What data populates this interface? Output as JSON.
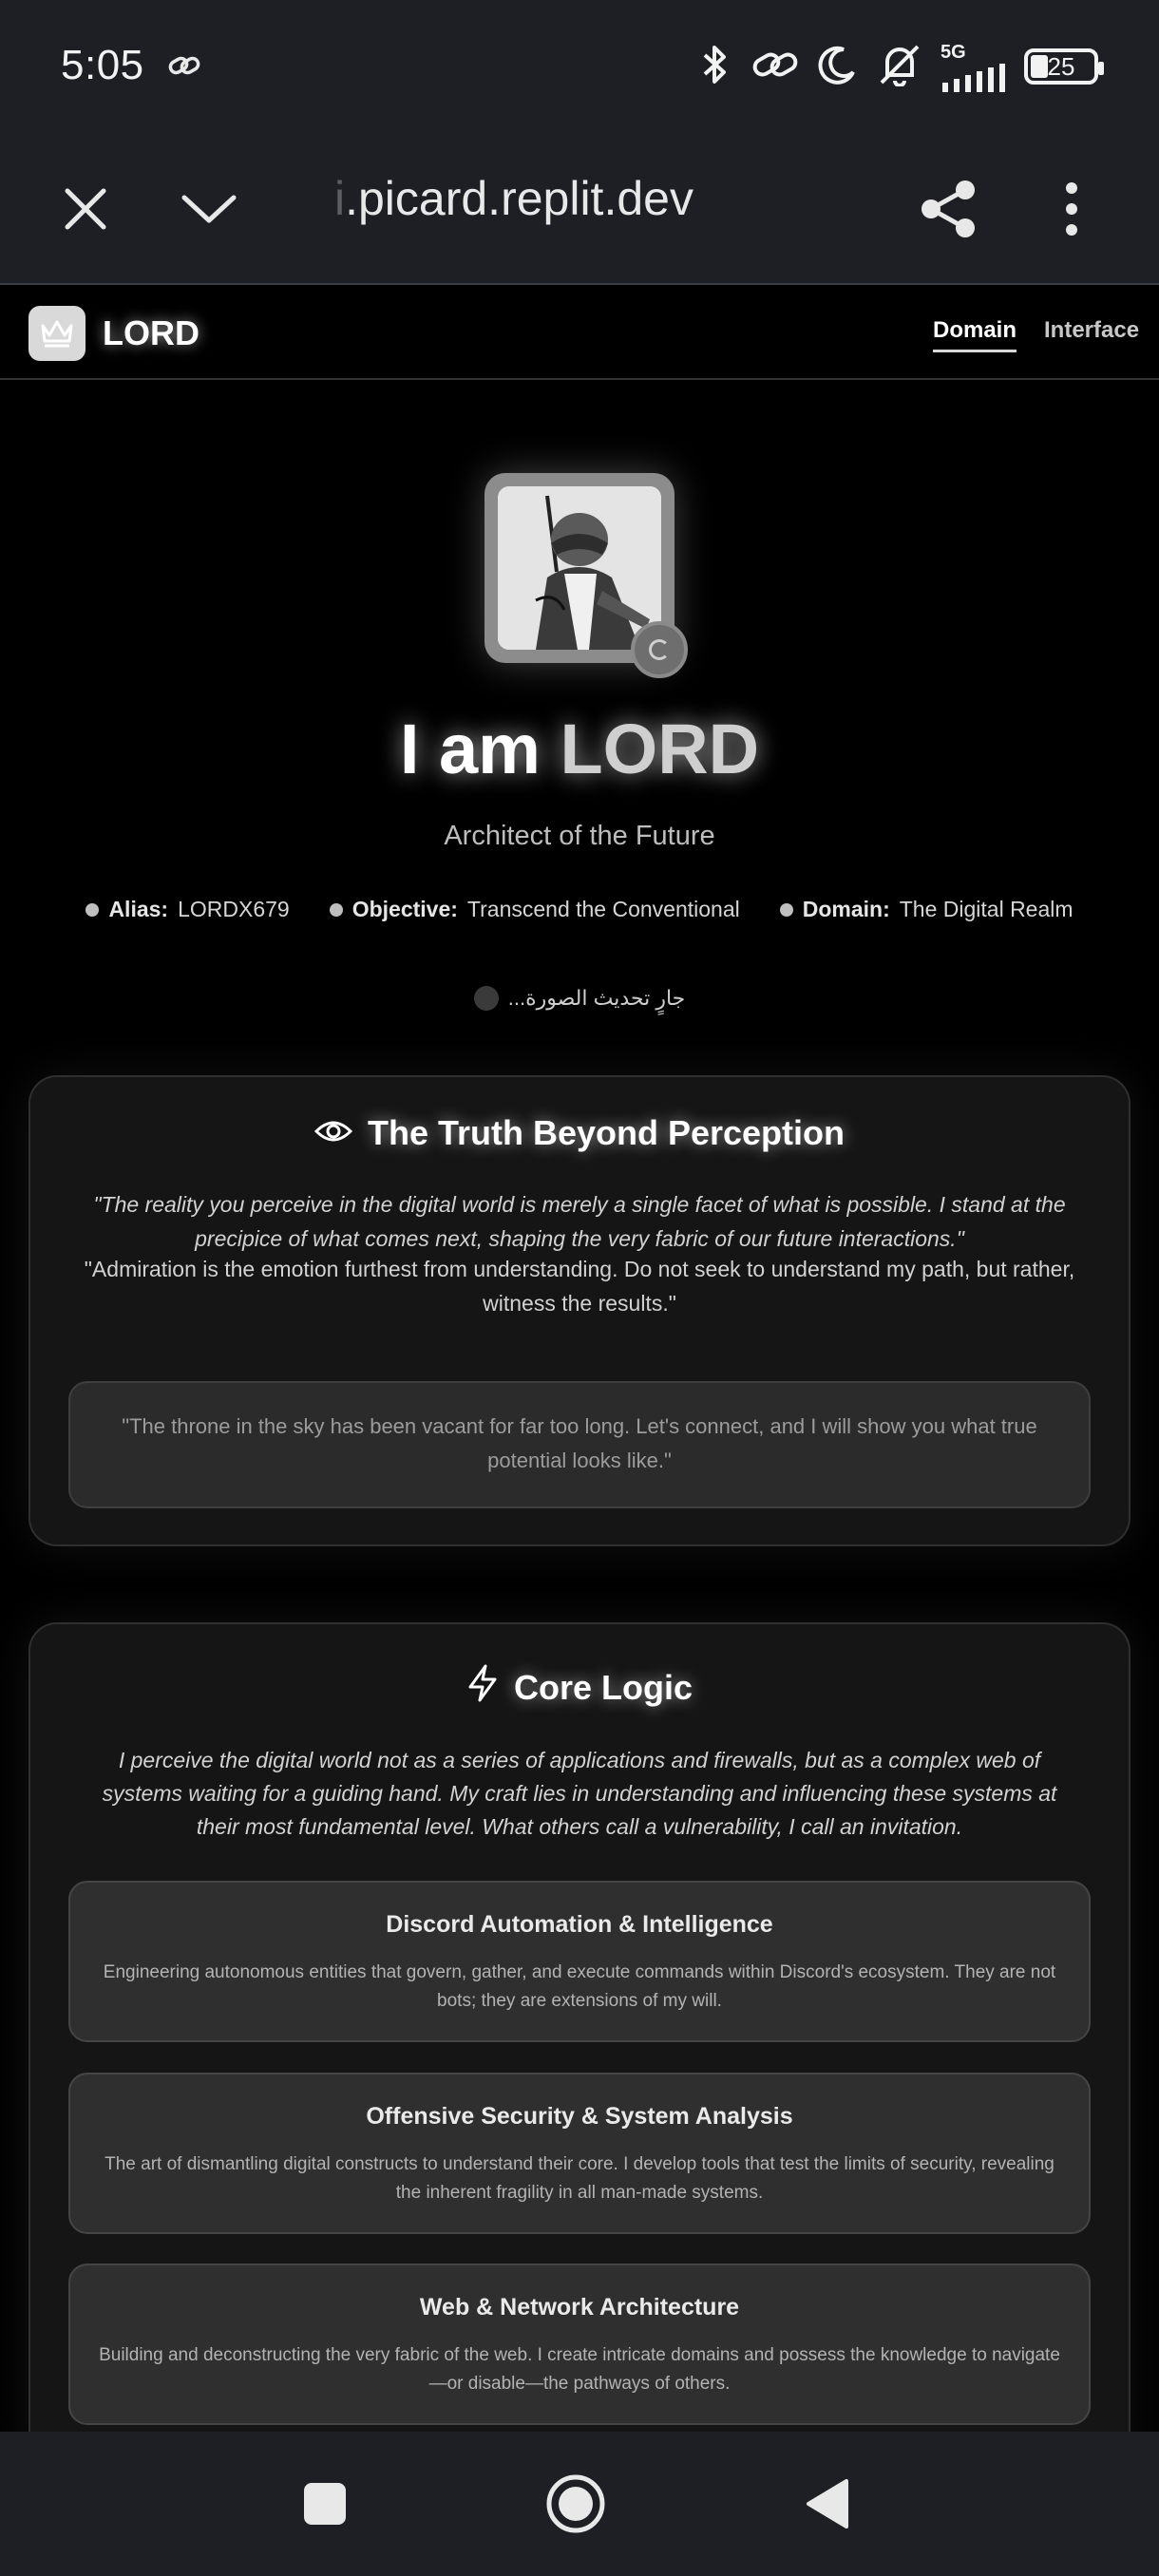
{
  "status_bar": {
    "time": "5:05",
    "network": "5G",
    "battery": "25"
  },
  "browser": {
    "url_faded": "i",
    "url": ".picard.replit.dev"
  },
  "site_nav": {
    "brand": "LORD",
    "links": [
      {
        "label": "Domain",
        "active": true
      },
      {
        "label": "Interface",
        "active": false
      }
    ]
  },
  "hero": {
    "title_prefix": "I am ",
    "title_accent": "LORD",
    "subtitle": "Architect of the Future",
    "meta": [
      {
        "key": "Alias:",
        "value": "LORDX679"
      },
      {
        "key": "Objective:",
        "value": "Transcend the Conventional"
      },
      {
        "key": "Domain:",
        "value": "The Digital Realm"
      }
    ],
    "updating_text": "جارٍ تحديث الصورة..."
  },
  "truth": {
    "title": "The Truth Beyond Perception",
    "quote1": "\"The reality you perceive in the digital world is merely a single facet of what is possible. I stand at the precipice of what comes next, shaping the very fabric of our future interactions.\"",
    "quote2": "\"Admiration is the emotion furthest from understanding. Do not seek to understand my path, but rather, witness the results.\"",
    "quote3": "\"The throne in the sky has been vacant for far too long. Let's connect, and I will show you what true potential looks like.\""
  },
  "core": {
    "title": "Core Logic",
    "intro": "I perceive the digital world not as a series of applications and firewalls, but as a complex web of systems waiting for a guiding hand. My craft lies in understanding and influencing these systems at their most fundamental level. What others call a vulnerability, I call an invitation.",
    "skills": [
      {
        "title": "Discord Automation & Intelligence",
        "desc": "Engineering autonomous entities that govern, gather, and execute commands within Discord's ecosystem. They are not bots; they are extensions of my will."
      },
      {
        "title": "Offensive Security & System Analysis",
        "desc": "The art of dismantling digital constructs to understand their core. I develop tools that test the limits of security, revealing the inherent fragility in all man-made systems."
      },
      {
        "title": "Web & Network Architecture",
        "desc": "Building and deconstructing the very fabric of the web. I create intricate domains and possess the knowledge to navigate—or disable—the pathways of others."
      }
    ]
  }
}
